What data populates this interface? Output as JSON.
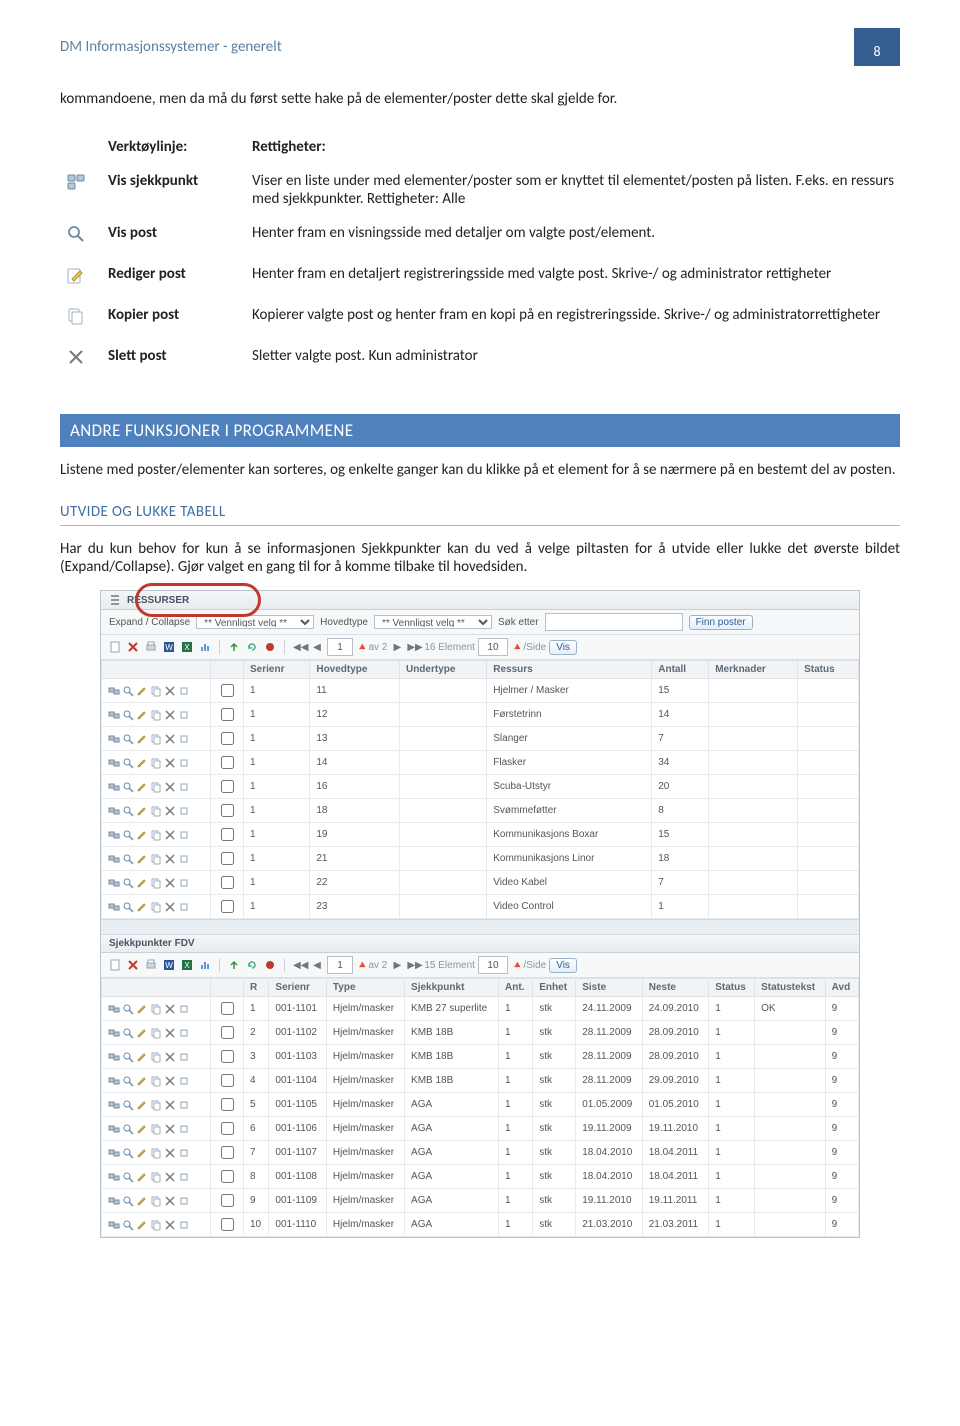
{
  "header": {
    "title": "DM Informasjonssystemer - generelt",
    "page_number": "8"
  },
  "intro": "kommandoene, men da må du først sette hake på de elementer/poster dette skal gjelde for.",
  "definitions": {
    "col1_header": "Verktøylinje:",
    "col2_header": "Rettigheter:",
    "rows": [
      {
        "icon": "checkpoints",
        "label": "Vis sjekkpunkt",
        "desc": "Viser en liste under med elementer/poster som er knyttet til elementet/posten på listen. F.eks. en ressurs med sjekkpunkter. Rettigheter: Alle"
      },
      {
        "icon": "magnifier",
        "label": "Vis post",
        "desc": "Henter fram en visningsside med detaljer om valgte post/element."
      },
      {
        "icon": "pencil",
        "label": "Rediger post",
        "desc": "Henter fram en detaljert registreringsside med valgte post. Skrive-/ og administrator rettigheter"
      },
      {
        "icon": "copy",
        "label": "Kopier post",
        "desc": "Kopierer valgte post og henter fram en kopi på en registreringsside. Skrive-/ og administratorrettigheter"
      },
      {
        "icon": "delete",
        "label": "Slett post",
        "desc": "Sletter valgte post. Kun administrator"
      }
    ]
  },
  "section_bar": "ANDRE FUNKSJONER I PROGRAMMENE",
  "section_para": "Listene med poster/elementer kan sorteres, og enkelte ganger kan du klikke på et element for å se nærmere på en bestemt del av posten.",
  "sub_heading": "UTVIDE OG LUKKE TABELL",
  "sub_para": "Har du kun behov for  kun å se informasjonen Sjekkpunkter kan du ved å velge piltasten for å utvide eller lukke det øverste bildet (Expand/Collapse). Gjør valget en gang til for å komme tilbake til hovedsiden.",
  "screenshot": {
    "panel1": {
      "title": "RESSURSER",
      "expand_label": "Expand / Collapse",
      "select1_placeholder": "** Vennligst velg **",
      "hovedtype_label": "Hovedtype",
      "select2_placeholder": "** Vennligst velg **",
      "sok_label": "Søk etter",
      "finn_btn": "Finn poster",
      "pager": {
        "prev2": "◀◀",
        "prev1": "◀",
        "current": "1",
        "av_label": "av 2",
        "next1": "▶",
        "next2": "▶▶",
        "count": "16 Element",
        "perpage_value": "10",
        "perpage_suffix": "/Side",
        "vis": "Vis"
      },
      "columns": [
        "",
        "",
        "Serienr",
        "Hovedtype",
        "Undertype",
        "Ressurs",
        "Antall",
        "Merknader",
        "Status"
      ],
      "rows": [
        {
          "serienr": "1",
          "hovedtype": "11",
          "undertype": "",
          "ressurs": "Hjelmer / Masker",
          "antall": "15"
        },
        {
          "serienr": "1",
          "hovedtype": "12",
          "undertype": "",
          "ressurs": "Førstetrinn",
          "antall": "14"
        },
        {
          "serienr": "1",
          "hovedtype": "13",
          "undertype": "",
          "ressurs": "Slanger",
          "antall": "7"
        },
        {
          "serienr": "1",
          "hovedtype": "14",
          "undertype": "",
          "ressurs": "Flasker",
          "antall": "34"
        },
        {
          "serienr": "1",
          "hovedtype": "16",
          "undertype": "",
          "ressurs": "Scuba-Utstyr",
          "antall": "20"
        },
        {
          "serienr": "1",
          "hovedtype": "18",
          "undertype": "",
          "ressurs": "Svømmeføtter",
          "antall": "8"
        },
        {
          "serienr": "1",
          "hovedtype": "19",
          "undertype": "",
          "ressurs": "Kommunikasjons Boxar",
          "antall": "15"
        },
        {
          "serienr": "1",
          "hovedtype": "21",
          "undertype": "",
          "ressurs": "Kommunikasjons Linor",
          "antall": "18"
        },
        {
          "serienr": "1",
          "hovedtype": "22",
          "undertype": "",
          "ressurs": "Video Kabel",
          "antall": "7"
        },
        {
          "serienr": "1",
          "hovedtype": "23",
          "undertype": "",
          "ressurs": "Video Control",
          "antall": "1"
        }
      ]
    },
    "panel2": {
      "title": "Sjekkpunkter FDV",
      "pager": {
        "prev2": "◀◀",
        "prev1": "◀",
        "current": "1",
        "av_label": "av 2",
        "next1": "▶",
        "next2": "▶▶",
        "count": "15 Element",
        "perpage_value": "10",
        "perpage_suffix": "/Side",
        "vis": "Vis"
      },
      "columns": [
        "",
        "",
        "R",
        "Serienr",
        "Type",
        "Sjekkpunkt",
        "Ant.",
        "Enhet",
        "Siste",
        "Neste",
        "Status",
        "Statustekst",
        "Avd"
      ],
      "rows": [
        {
          "n": "1",
          "serienr": "001-1101",
          "type": "Hjelm/masker",
          "sjekk": "KMB 27 superlite",
          "ant": "1",
          "enhet": "stk",
          "siste": "24.11.2009",
          "neste": "24.09.2010",
          "status": "1",
          "tekst": "OK",
          "avd": "9"
        },
        {
          "n": "2",
          "serienr": "001-1102",
          "type": "Hjelm/masker",
          "sjekk": "KMB 18B",
          "ant": "1",
          "enhet": "stk",
          "siste": "28.11.2009",
          "neste": "28.09.2010",
          "status": "1",
          "tekst": "",
          "avd": "9"
        },
        {
          "n": "3",
          "serienr": "001-1103",
          "type": "Hjelm/masker",
          "sjekk": "KMB 18B",
          "ant": "1",
          "enhet": "stk",
          "siste": "28.11.2009",
          "neste": "28.09.2010",
          "status": "1",
          "tekst": "",
          "avd": "9"
        },
        {
          "n": "4",
          "serienr": "001-1104",
          "type": "Hjelm/masker",
          "sjekk": "KMB 18B",
          "ant": "1",
          "enhet": "stk",
          "siste": "28.11.2009",
          "neste": "29.09.2010",
          "status": "1",
          "tekst": "",
          "avd": "9"
        },
        {
          "n": "5",
          "serienr": "001-1105",
          "type": "Hjelm/masker",
          "sjekk": "AGA",
          "ant": "1",
          "enhet": "stk",
          "siste": "01.05.2009",
          "neste": "01.05.2010",
          "status": "1",
          "tekst": "",
          "avd": "9"
        },
        {
          "n": "6",
          "serienr": "001-1106",
          "type": "Hjelm/masker",
          "sjekk": "AGA",
          "ant": "1",
          "enhet": "stk",
          "siste": "19.11.2009",
          "neste": "19.11.2010",
          "status": "1",
          "tekst": "",
          "avd": "9"
        },
        {
          "n": "7",
          "serienr": "001-1107",
          "type": "Hjelm/masker",
          "sjekk": "AGA",
          "ant": "1",
          "enhet": "stk",
          "siste": "18.04.2010",
          "neste": "18.04.2011",
          "status": "1",
          "tekst": "",
          "avd": "9"
        },
        {
          "n": "8",
          "serienr": "001-1108",
          "type": "Hjelm/masker",
          "sjekk": "AGA",
          "ant": "1",
          "enhet": "stk",
          "siste": "18.04.2010",
          "neste": "18.04.2011",
          "status": "1",
          "tekst": "",
          "avd": "9"
        },
        {
          "n": "9",
          "serienr": "001-1109",
          "type": "Hjelm/masker",
          "sjekk": "AGA",
          "ant": "1",
          "enhet": "stk",
          "siste": "19.11.2010",
          "neste": "19.11.2011",
          "status": "1",
          "tekst": "",
          "avd": "9"
        },
        {
          "n": "10",
          "serienr": "001-1110",
          "type": "Hjelm/masker",
          "sjekk": "AGA",
          "ant": "1",
          "enhet": "stk",
          "siste": "21.03.2010",
          "neste": "21.03.2011",
          "status": "1",
          "tekst": "",
          "avd": "9"
        }
      ]
    }
  }
}
